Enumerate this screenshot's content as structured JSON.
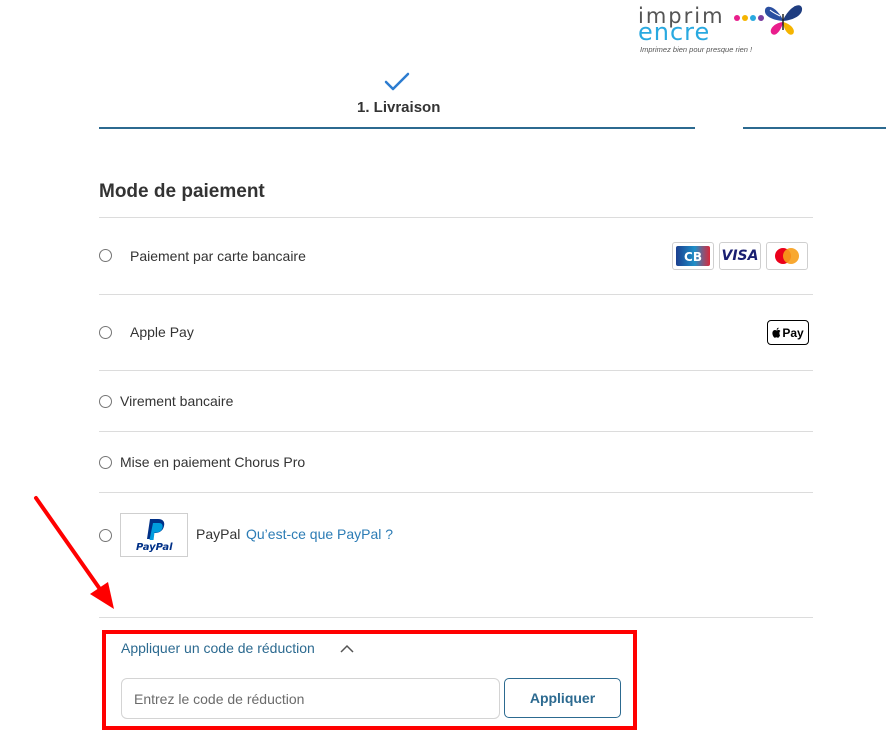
{
  "logo": {
    "line1": "imprim",
    "line2": "encre",
    "tagline": "Imprimez bien pour presque rien !",
    "dot_colors": [
      "#e91e8c",
      "#f5b400",
      "#29a9e0",
      "#7a3fa0"
    ]
  },
  "stepper": {
    "step1_label": "1. Livraison",
    "accent": "#2c6a90"
  },
  "payment": {
    "title": "Mode de paiement",
    "options": [
      {
        "label": "Paiement par carte bancaire"
      },
      {
        "label": "Apple Pay"
      },
      {
        "label": "Virement bancaire"
      },
      {
        "label": "Mise en paiement Chorus Pro"
      },
      {
        "label": "PayPal",
        "link": "Qu’est-ce que PayPal ?"
      }
    ],
    "card_logos": [
      "CB",
      "VISA",
      "Mastercard"
    ],
    "applepay_badge": "Pay",
    "paypal_logo": "PayPal"
  },
  "discount": {
    "toggle_label": "Appliquer un code de réduction",
    "input_placeholder": "Entrez le code de réduction",
    "button_label": "Appliquer"
  },
  "annotation": {
    "color": "#ff0000"
  }
}
